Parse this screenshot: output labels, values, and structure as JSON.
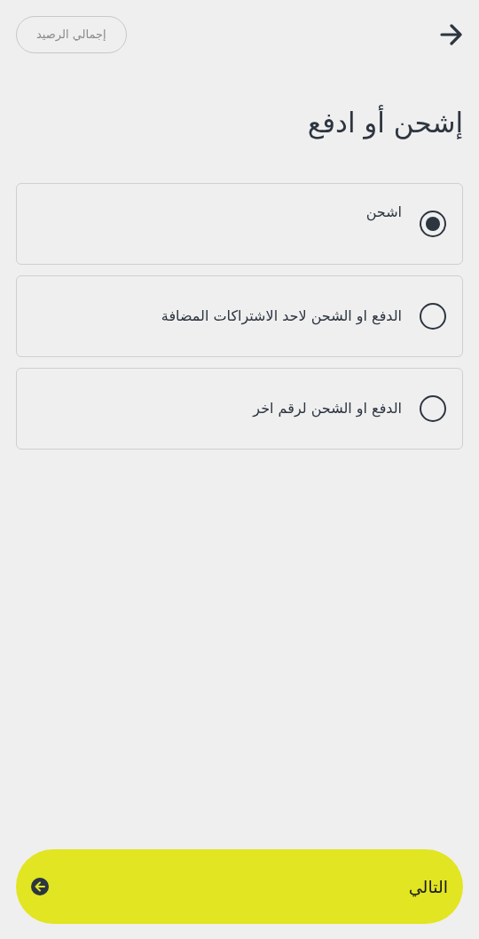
{
  "header": {
    "balance_button": "إجمالي الرصيد"
  },
  "title": "إشحن أو ادفع",
  "options": [
    {
      "label": "اشحن",
      "selected": true
    },
    {
      "label": "الدفع او الشحن لاحد الاشتراكات المضافة",
      "selected": false
    },
    {
      "label": "الدفع او الشحن لرقم اخر",
      "selected": false
    }
  ],
  "next_button": "التالي"
}
